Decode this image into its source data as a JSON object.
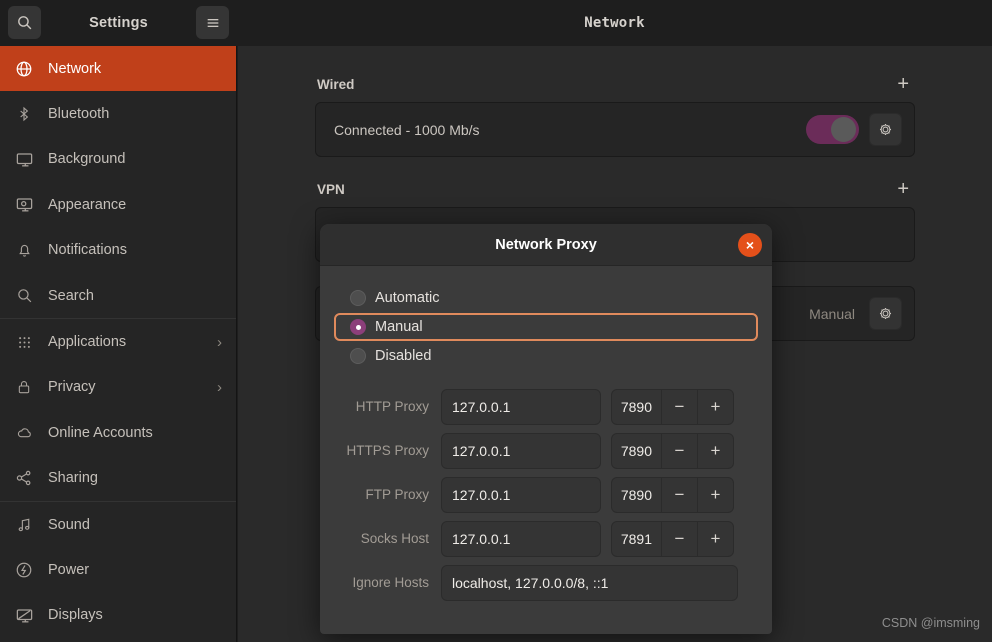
{
  "header": {
    "search_icon": "search-icon",
    "app_title": "Settings",
    "menu_icon": "hamburger-menu-icon",
    "page_title": "Network"
  },
  "sidebar": {
    "items": [
      {
        "label": "Network",
        "icon": "globe-icon",
        "active": true,
        "chevron": ""
      },
      {
        "label": "Bluetooth",
        "icon": "bluetooth-icon",
        "active": false,
        "chevron": ""
      },
      {
        "label": "Background",
        "icon": "monitor-icon",
        "active": false,
        "chevron": ""
      },
      {
        "label": "Appearance",
        "icon": "appearance-icon",
        "active": false,
        "chevron": ""
      },
      {
        "label": "Notifications",
        "icon": "bell-icon",
        "active": false,
        "chevron": ""
      },
      {
        "label": "Search",
        "icon": "search-icon",
        "active": false,
        "chevron": ""
      },
      {
        "label": "Applications",
        "icon": "grid-dots-icon",
        "active": false,
        "chevron": "›"
      },
      {
        "label": "Privacy",
        "icon": "lock-icon",
        "active": false,
        "chevron": "›"
      },
      {
        "label": "Online Accounts",
        "icon": "cloud-icon",
        "active": false,
        "chevron": ""
      },
      {
        "label": "Sharing",
        "icon": "share-nodes-icon",
        "active": false,
        "chevron": ""
      },
      {
        "label": "Sound",
        "icon": "music-note-icon",
        "active": false,
        "chevron": ""
      },
      {
        "label": "Power",
        "icon": "power-icon",
        "active": false,
        "chevron": ""
      },
      {
        "label": "Displays",
        "icon": "displays-icon",
        "active": false,
        "chevron": ""
      }
    ]
  },
  "main": {
    "wired": {
      "title": "Wired",
      "add_label": "+",
      "status": "Connected - 1000 Mb/s",
      "toggle_on": true,
      "settings_icon": "gear-icon"
    },
    "vpn": {
      "title": "VPN",
      "add_label": "+"
    },
    "proxy_row": {
      "value": "Manual",
      "settings_icon": "gear-icon"
    }
  },
  "dialog": {
    "title": "Network Proxy",
    "close_label": "×",
    "modes": [
      {
        "label": "Automatic",
        "selected": false
      },
      {
        "label": "Manual",
        "selected": true
      },
      {
        "label": "Disabled",
        "selected": false
      }
    ],
    "fields": [
      {
        "label": "HTTP Proxy",
        "host": "127.0.0.1",
        "port": "7890",
        "minus": "−",
        "plus": "+"
      },
      {
        "label": "HTTPS Proxy",
        "host": "127.0.0.1",
        "port": "7890",
        "minus": "−",
        "plus": "+"
      },
      {
        "label": "FTP Proxy",
        "host": "127.0.0.1",
        "port": "7890",
        "minus": "−",
        "plus": "+"
      },
      {
        "label": "Socks Host",
        "host": "127.0.0.1",
        "port": "7891",
        "minus": "−",
        "plus": "+"
      }
    ],
    "ignore": {
      "label": "Ignore Hosts",
      "value": "localhost, 127.0.0.0/8, ::1"
    }
  },
  "watermark": "CSDN @imsming",
  "colors": {
    "accent_active": "#c0401a",
    "close_button": "#e4501a",
    "focus_outline": "#e08a5c",
    "toggle_on": "#6b2c59",
    "radio_on": "#8c3f7a"
  }
}
